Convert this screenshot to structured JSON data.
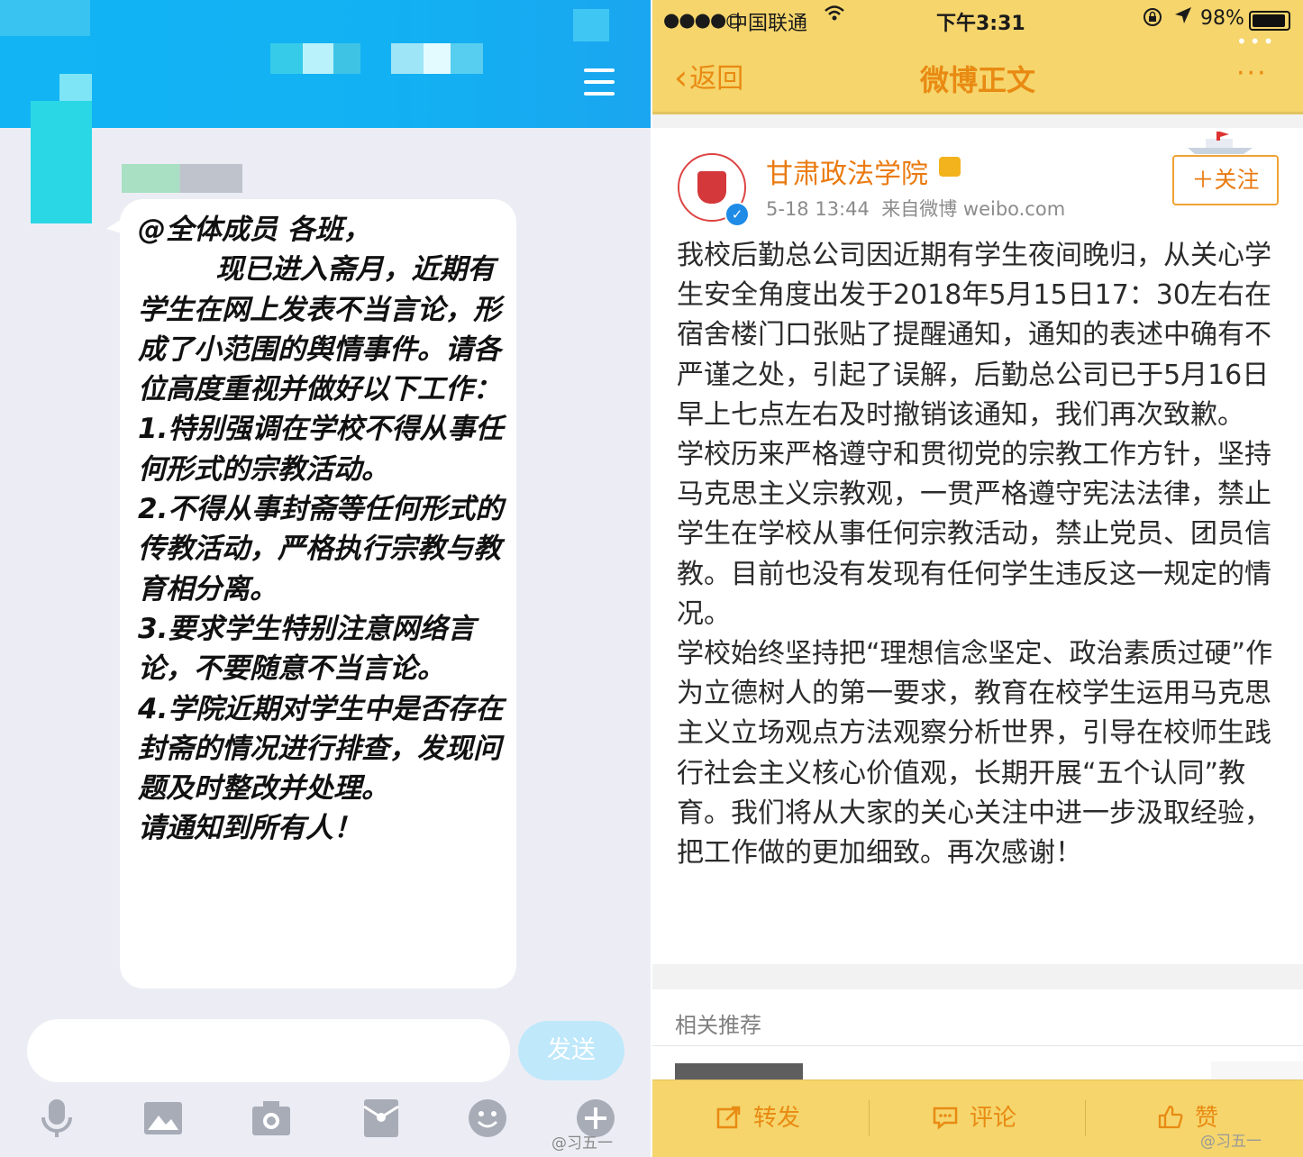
{
  "qq_chat": {
    "message_text": "@全体成员 各班，\n        现已进入斋月，近期有学生在网上发表不当言论，形成了小范围的舆情事件。请各位高度重视并做好以下工作：\n1.特别强调在学校不得从事任何形式的宗教活动。\n2.不得从事封斋等任何形式的传教活动，严格执行宗教与教育相分离。\n3.要求学生特别注意网络言论，不要随意不当言论。\n4.学院近期对学生中是否存在封斋的情况进行排查，发现问题及时整改并处理。\n请通知到所有人！",
    "input_placeholder": "",
    "send_label": "发送",
    "toolbar_icons": [
      "microphone-icon",
      "image-icon",
      "camera-icon",
      "red-packet-icon",
      "emoji-icon",
      "plus-icon"
    ],
    "watermark": "@习五一",
    "colors": {
      "header": "#12b4f4",
      "background": "#ecedf4",
      "send_button": "#bfe8fb",
      "icon": "#a7acb7"
    }
  },
  "weibo": {
    "status_bar": {
      "signal": "●●●●○",
      "carrier": "中国联通",
      "time": "下午3:31",
      "battery": "98%"
    },
    "nav": {
      "back_label": "返回",
      "title": "微博正文",
      "more_label": "···"
    },
    "post": {
      "author": "甘肃政法学院",
      "timestamp": "5-18 13:44",
      "source": "来自微博 weibo.com",
      "follow_label": "＋关注",
      "body": "我校后勤总公司因近期有学生夜间晚归，从关心学生安全角度出发于2018年5月15日17：30左右在宿舍楼门口张贴了提醒通知，通知的表述中确有不严谨之处，引起了误解，后勤总公司已于5月16日早上七点左右及时撤销该通知，我们再次致歉。\n学校历来严格遵守和贯彻党的宗教工作方针，坚持马克思主义宗教观，一贯严格遵守宪法法律，禁止学生在学校从事任何宗教活动，禁止党员、团员信教。目前也没有发现有任何学生违反这一规定的情况。\n学校始终坚持把“理想信念坚定、政治素质过硬”作为立德树人的第一要求，教育在校学生运用马克思主义立场观点方法观察分析世界，引导在校师生践行社会主义核心价值观，长期开展“五个认同”教育。我们将从大家的关心关注中进一步汲取经验，把工作做的更加细致。再次感谢！"
    },
    "recommend_title": "相关推荐",
    "toolbar": {
      "repost": "转发",
      "comment": "评论",
      "like": "赞"
    },
    "watermark": "@习五一",
    "colors": {
      "header": "#f5d56c",
      "accent": "#e98a12",
      "name": "#ea7a10",
      "verified": "#1e8be6"
    }
  }
}
